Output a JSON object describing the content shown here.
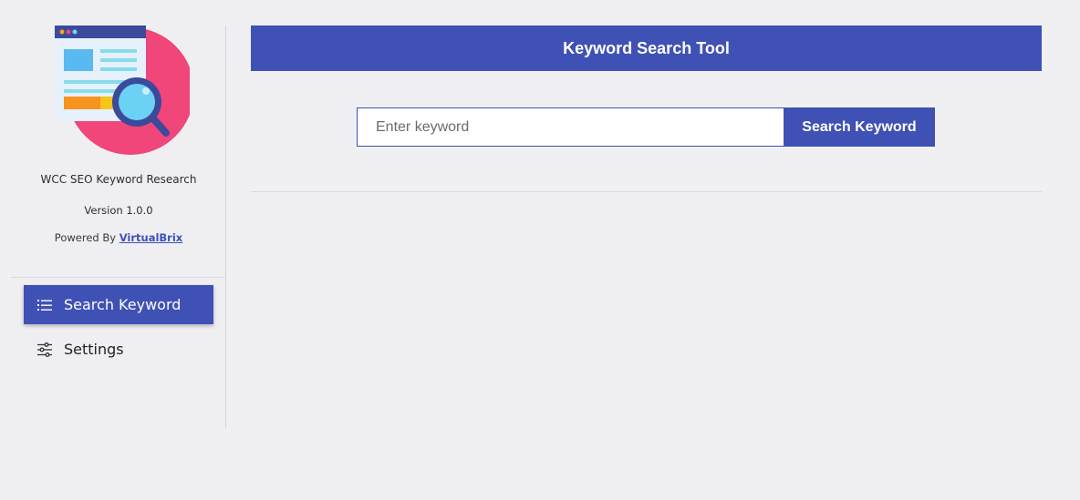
{
  "sidebar": {
    "logo_icon": "seo-magnifier-browser-icon",
    "plugin_name": "WCC SEO Keyword Research",
    "version": "Version 1.0.0",
    "powered_prefix": "Powered By",
    "powered_link": "VirtualBrix",
    "nav": [
      {
        "label": "Search Keyword",
        "icon": "list-icon",
        "active": true
      },
      {
        "label": "Settings",
        "icon": "sliders-icon",
        "active": false
      }
    ]
  },
  "main": {
    "title": "Keyword Search Tool",
    "search": {
      "placeholder": "Enter keyword",
      "value": "",
      "button_label": "Search Keyword"
    }
  },
  "colors": {
    "accent": "#3f51b5",
    "background": "#f0f0f3",
    "logo_circle": "#f0467a"
  }
}
